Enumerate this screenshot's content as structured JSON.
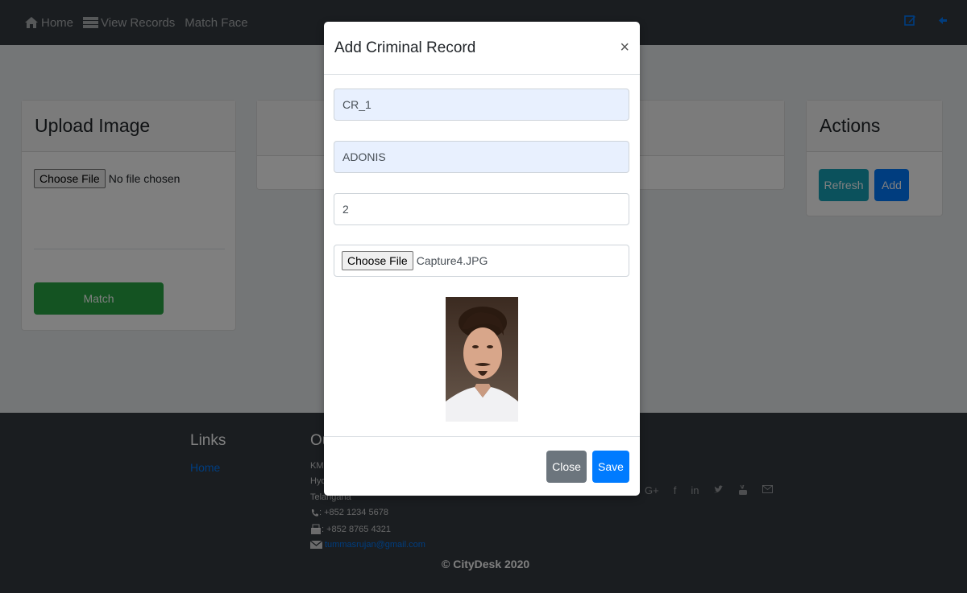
{
  "nav": {
    "items": [
      {
        "label": "Home",
        "icon": "home-icon"
      },
      {
        "label": "View Records",
        "icon": "list-icon"
      },
      {
        "label": "Match Face",
        "icon": ""
      }
    ],
    "right_icons": [
      "edit-icon",
      "logout-icon"
    ],
    "accent": "#007bff"
  },
  "upload_card": {
    "title": "Upload Image",
    "file_button": "Choose File",
    "file_status": "No file chosen",
    "match_button": "Match"
  },
  "actions_card": {
    "title": "Actions",
    "refresh_button": "Refresh",
    "add_button": "Add"
  },
  "footer": {
    "links_heading": "Links",
    "links": [
      "Home"
    ],
    "our_heading": "Ou",
    "addr_line1": "KM",
    "addr_line2": "Hyd",
    "addr_line3": "Telangana",
    "phone": ": +852 1234 5678",
    "fax": ": +852 8765 4321",
    "email": "tummasrujan@gmail.com",
    "copyright": "© CityDesk 2020",
    "social_icons": [
      "google-plus-icon",
      "facebook-icon",
      "linkedin-icon",
      "twitter-icon",
      "youtube-icon",
      "mail-icon"
    ]
  },
  "modal": {
    "title": "Add Criminal Record",
    "close_glyph": "×",
    "id_value": "CR_1",
    "name_value": "ADONIS",
    "count_value": "2",
    "file_button": "Choose File",
    "file_name": "Capture4.JPG",
    "close_button": "Close",
    "save_button": "Save"
  }
}
